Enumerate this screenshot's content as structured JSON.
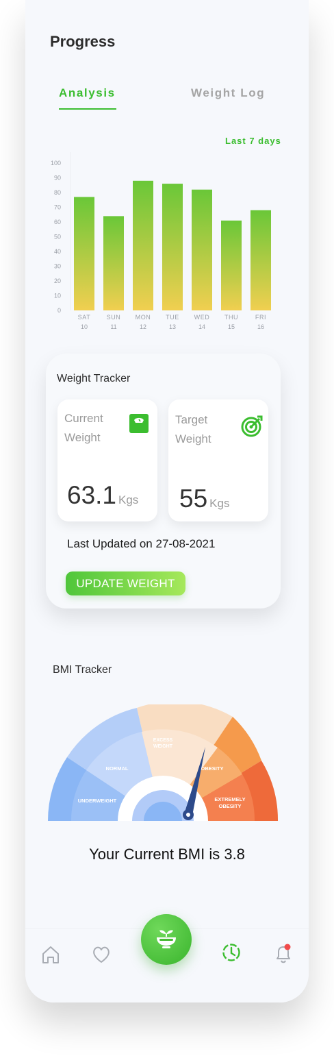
{
  "header": {
    "title": "Progress"
  },
  "tabs": [
    {
      "label": "Analysis",
      "active": true
    },
    {
      "label": "Weight Log",
      "active": false
    }
  ],
  "range_label": "Last 7 days",
  "chart_data": {
    "type": "bar",
    "categories": [
      "SAT",
      "SUN",
      "MON",
      "TUE",
      "WED",
      "THU",
      "FRI"
    ],
    "category_dates": [
      "10",
      "11",
      "12",
      "13",
      "14",
      "15",
      "16"
    ],
    "values": [
      77,
      64,
      88,
      86,
      82,
      61,
      68
    ],
    "yticks": [
      0,
      10,
      20,
      30,
      40,
      50,
      60,
      70,
      80,
      90,
      100
    ],
    "ylim": [
      0,
      100
    ],
    "gradient_top": "#6ac738",
    "gradient_bottom": "#f1cf50",
    "grid": false
  },
  "weight_tracker": {
    "title": "Weight Tracker",
    "current": {
      "label": "Current Weight",
      "value": "63.1",
      "unit": "Kgs",
      "icon": "scale-icon"
    },
    "target": {
      "label": "Target Weight",
      "value": "55",
      "unit": "Kgs",
      "icon": "target-icon"
    },
    "last_updated": "Last Updated on 27-08-2021",
    "button_label": "UPDATE WEIGHT"
  },
  "bmi_tracker": {
    "title": "BMI Tracker",
    "segments": [
      "UNDERWEIGHT",
      "NORMAL",
      "EXCESS WEIGHT",
      "OBESITY",
      "EXTREMELY OBESITY"
    ],
    "current_text": "Your Current BMI is 3.8"
  },
  "colors": {
    "accent": "#3bbd2f",
    "underweight": "#8ab6f5",
    "normal": "#b4cef8",
    "excess": "#f9ddc2",
    "obesity": "#f59a4c",
    "extremely_obese": "#ee6a3a",
    "needle": "#2d4a8a"
  },
  "nav": [
    "home-icon",
    "heart-icon",
    "salad-bowl-icon",
    "history-icon",
    "bell-icon"
  ]
}
